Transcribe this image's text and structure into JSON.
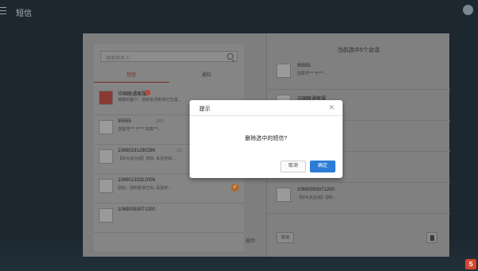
{
  "app": {
    "title": "短信"
  },
  "left_pane": {
    "search_placeholder": "搜索联系人",
    "tabs": [
      "短信",
      "通知"
    ],
    "conversations": [
      {
        "name": "中国联通客服",
        "count": "",
        "preview": "尊敬的客户，您的本月账单已生成…",
        "checked": false
      },
      {
        "name": "95555",
        "count": "(80)",
        "preview": "您尾号*** 于*** 扣款***…",
        "checked": false
      },
      {
        "name": "10690191290296",
        "count": "(1)",
        "preview": "【好大夫在线】您好, 本次咨询…",
        "checked": false
      },
      {
        "name": "10690133312006",
        "count": "",
        "preview": "您好，您的账单已出, 请及时…",
        "checked": true
      },
      {
        "name": "10690093071200",
        "count": "",
        "preview": "",
        "checked": false
      }
    ],
    "footer_label": "返回"
  },
  "right_pane": {
    "header": "当前选中5个会话",
    "items": [
      {
        "name": "95555",
        "count": "(80)",
        "preview": "您尾号*** 于***…"
      },
      {
        "name": "中国联通客服",
        "count": "",
        "preview": "尊敬的客户…"
      },
      {
        "name": "",
        "count": "",
        "preview": ""
      },
      {
        "name": "",
        "count": "",
        "preview": ""
      },
      {
        "name": "10690093071200",
        "count": "",
        "preview": "【好大夫在线】您好…"
      }
    ],
    "cancel_label": "取消"
  },
  "dialog": {
    "title": "提示",
    "message": "删除选中的短信?",
    "cancel_label": "取消",
    "ok_label": "确定"
  },
  "corner_logo": "S"
}
